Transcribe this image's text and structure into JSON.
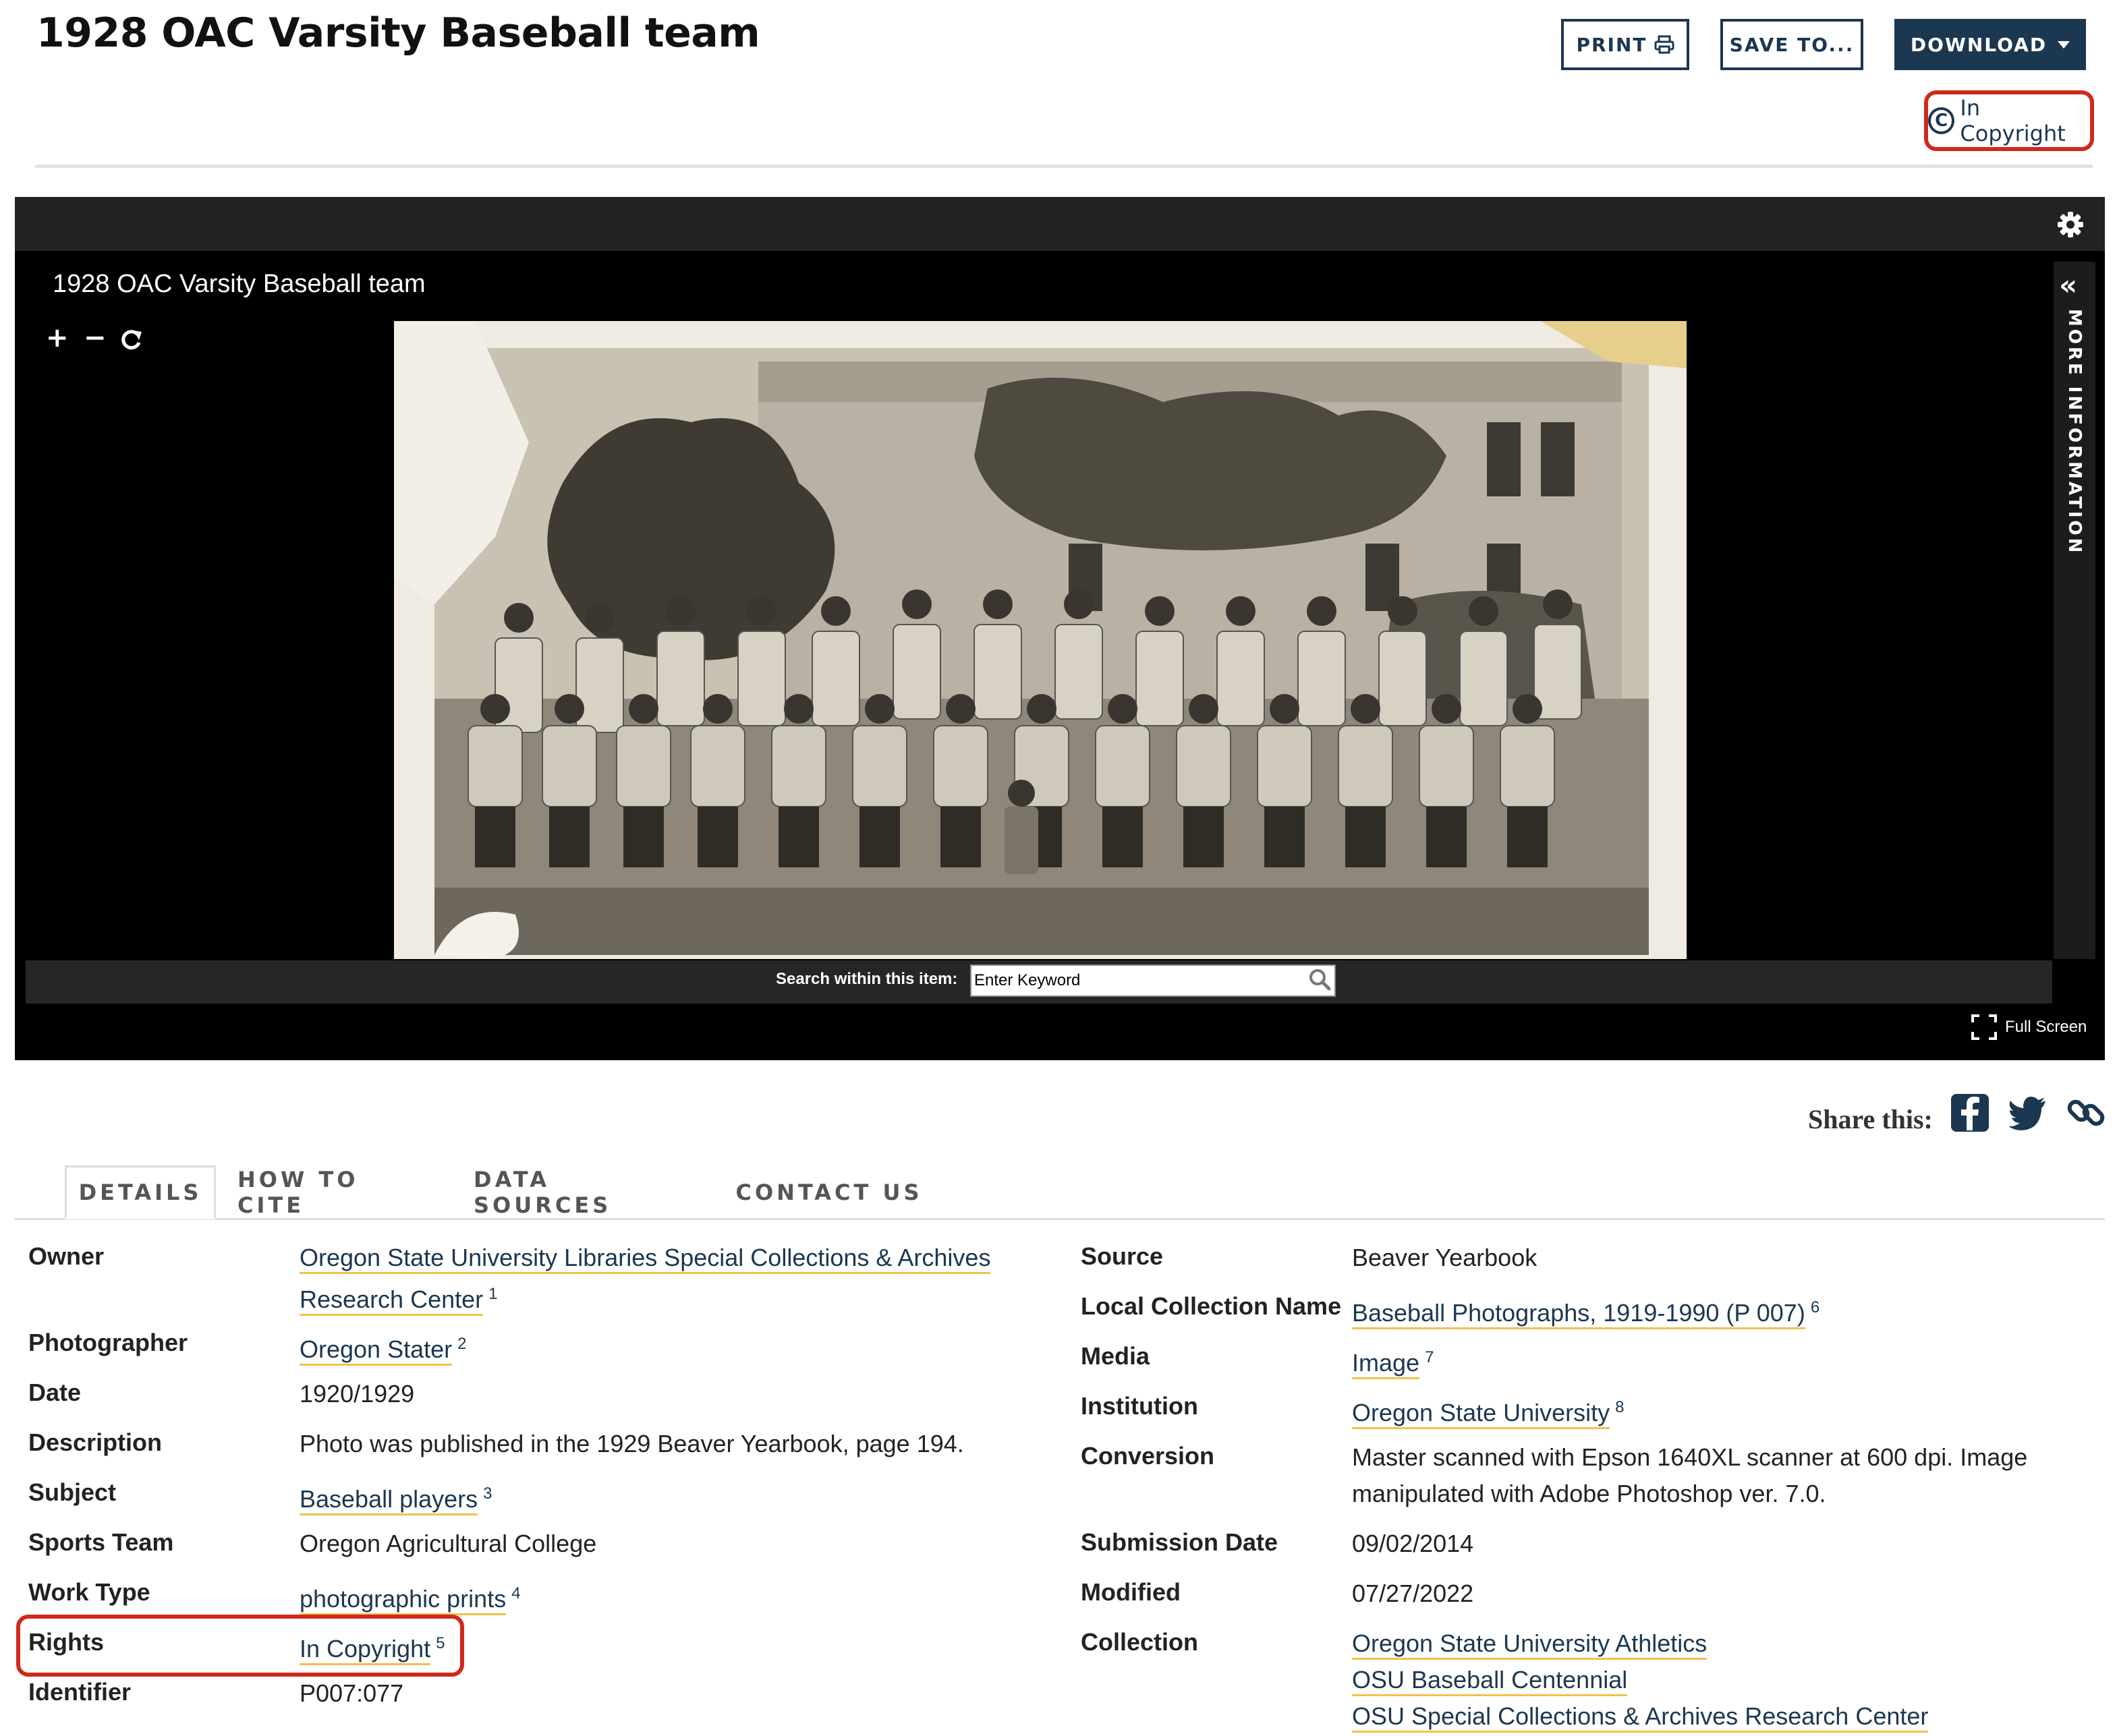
{
  "header": {
    "title": "1928 OAC Varsity Baseball team",
    "print_label": "PRINT",
    "save_label": "SAVE TO...",
    "download_label": "DOWNLOAD",
    "rights_badge": "In Copyright",
    "rights_symbol": "C"
  },
  "viewer": {
    "title": "1928 OAC Varsity Baseball team",
    "zoom_in": "+",
    "zoom_out": "−",
    "side_panel_label": "MORE INFORMATION",
    "search_label": "Search within this item:",
    "search_placeholder": "Enter Keyword",
    "fullscreen_label": "Full Screen"
  },
  "share": {
    "label": "Share this:"
  },
  "tabs": [
    {
      "label": "DETAILS",
      "active": true
    },
    {
      "label": "HOW TO CITE",
      "active": false
    },
    {
      "label": "DATA SOURCES",
      "active": false
    },
    {
      "label": "CONTACT US",
      "active": false
    }
  ],
  "details_left": {
    "owner": {
      "label": "Owner",
      "line1": "Oregon State University Libraries Special Collections & Archives",
      "line2": "Research Center",
      "fn": "1"
    },
    "photographer": {
      "label": "Photographer",
      "value": "Oregon Stater",
      "fn": "2"
    },
    "date": {
      "label": "Date",
      "value": "1920/1929"
    },
    "description": {
      "label": "Description",
      "value": "Photo was published in the 1929 Beaver Yearbook, page 194."
    },
    "subject": {
      "label": "Subject",
      "value": "Baseball players",
      "fn": "3"
    },
    "sports_team": {
      "label": "Sports Team",
      "value": "Oregon Agricultural College"
    },
    "work_type": {
      "label": "Work Type",
      "value": "photographic prints",
      "fn": "4"
    },
    "rights": {
      "label": "Rights",
      "value": "In Copyright",
      "fn": "5"
    },
    "identifier": {
      "label": "Identifier",
      "value": "P007:077"
    }
  },
  "details_right": {
    "source": {
      "label": "Source",
      "value": "Beaver Yearbook"
    },
    "local_collection": {
      "label": "Local Collection Name",
      "value": "Baseball Photographs, 1919-1990 (P 007)",
      "fn": "6"
    },
    "media": {
      "label": "Media",
      "value": "Image",
      "fn": "7"
    },
    "institution": {
      "label": "Institution",
      "value": "Oregon State University",
      "fn": "8"
    },
    "conversion": {
      "label": "Conversion",
      "line1": "Master scanned with Epson 1640XL scanner at 600 dpi. Image",
      "line2": "manipulated with Adobe Photoshop ver. 7.0."
    },
    "submission_date": {
      "label": "Submission Date",
      "value": "09/02/2014"
    },
    "modified": {
      "label": "Modified",
      "value": "07/27/2022"
    },
    "collection": {
      "label": "Collection",
      "values": [
        "Oregon State University Athletics",
        "OSU Baseball Centennial",
        "OSU Special Collections & Archives Research Center"
      ]
    }
  },
  "colors": {
    "navy": "#1c3750",
    "highlight_red": "#d0291c",
    "link_underline": "#f0c24d"
  }
}
